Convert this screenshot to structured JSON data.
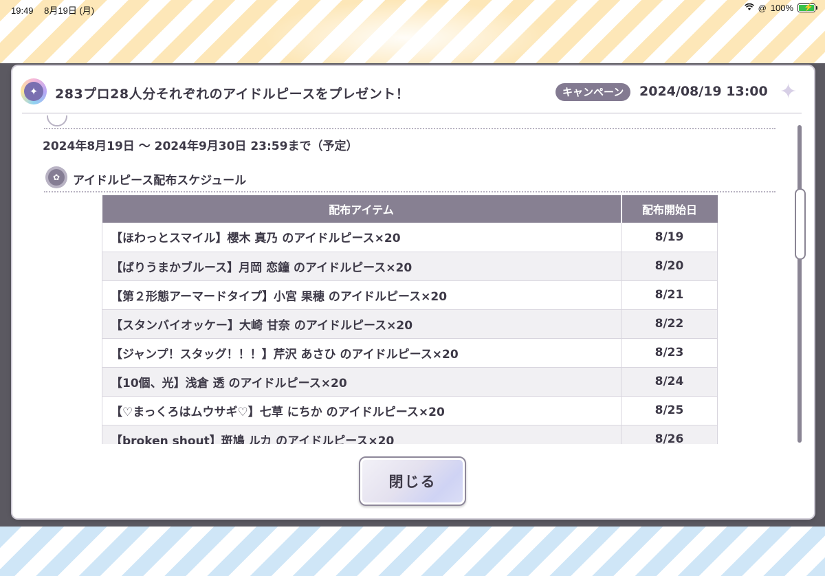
{
  "statusbar": {
    "time": "19:49",
    "date": "8月19日 (月)",
    "wifi_icon": "wifi-icon",
    "orientation_icon": "orientation-lock-icon",
    "battery_percent": "100%",
    "battery_level": 1.0
  },
  "dialog": {
    "title": "283プロ28人分それぞれのアイドルピースをプレゼント！",
    "category_badge": "キャンペーン",
    "posted_date": "2024/08/19 13:00",
    "period": "2024年8月19日 〜 2024年9月30日 23:59まで（予定）",
    "section_title": "アイドルピース配布スケジュール",
    "table": {
      "headers": [
        "配布アイテム",
        "配布開始日"
      ],
      "rows": [
        [
          "【ほわっとスマイル】櫻木 真乃 のアイドルピース×20",
          "8/19"
        ],
        [
          "【ばりうまかブルース】月岡 恋鐘 のアイドルピース×20",
          "8/20"
        ],
        [
          "【第２形態アーマードタイプ】小宮 果穂 のアイドルピース×20",
          "8/21"
        ],
        [
          "【スタンバイオッケー】大崎 甘奈 のアイドルピース×20",
          "8/22"
        ],
        [
          "【ジャンプ！スタッグ！！！】芹沢 あさひ のアイドルピース×20",
          "8/23"
        ],
        [
          "【10個、光】浅倉 透 のアイドルピース×20",
          "8/24"
        ],
        [
          "【♡まっくろはムウサギ♡】七草 にちか のアイドルピース×20",
          "8/25"
        ],
        [
          "【broken shout】斑鳩 ルカ のアイドルピース×20",
          "8/26"
        ]
      ]
    },
    "close_label": "閉じる"
  },
  "colors": {
    "header_bg": "#878092",
    "badge_bg": "#837a91",
    "text": "#3d3947"
  }
}
